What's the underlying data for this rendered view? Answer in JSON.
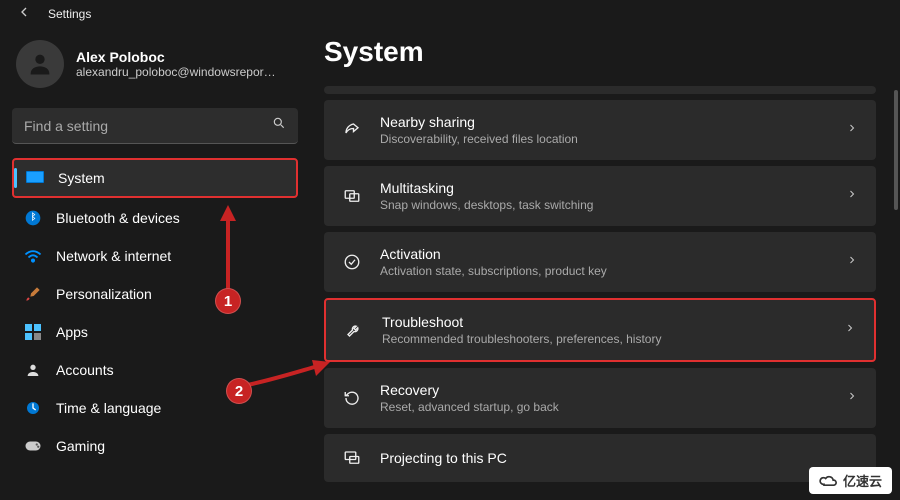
{
  "header": {
    "title": "Settings"
  },
  "user": {
    "name": "Alex Poloboc",
    "email": "alexandru_poloboc@windowsreport..."
  },
  "search": {
    "placeholder": "Find a setting"
  },
  "sidebar": {
    "items": [
      {
        "label": "System"
      },
      {
        "label": "Bluetooth & devices"
      },
      {
        "label": "Network & internet"
      },
      {
        "label": "Personalization"
      },
      {
        "label": "Apps"
      },
      {
        "label": "Accounts"
      },
      {
        "label": "Time & language"
      },
      {
        "label": "Gaming"
      }
    ]
  },
  "page": {
    "title": "System"
  },
  "cards": [
    {
      "title": "Nearby sharing",
      "sub": "Discoverability, received files location"
    },
    {
      "title": "Multitasking",
      "sub": "Snap windows, desktops, task switching"
    },
    {
      "title": "Activation",
      "sub": "Activation state, subscriptions, product key"
    },
    {
      "title": "Troubleshoot",
      "sub": "Recommended troubleshooters, preferences, history"
    },
    {
      "title": "Recovery",
      "sub": "Reset, advanced startup, go back"
    },
    {
      "title": "Projecting to this PC",
      "sub": ""
    }
  ],
  "annotations": {
    "step1": "1",
    "step2": "2"
  },
  "watermark": "亿速云"
}
